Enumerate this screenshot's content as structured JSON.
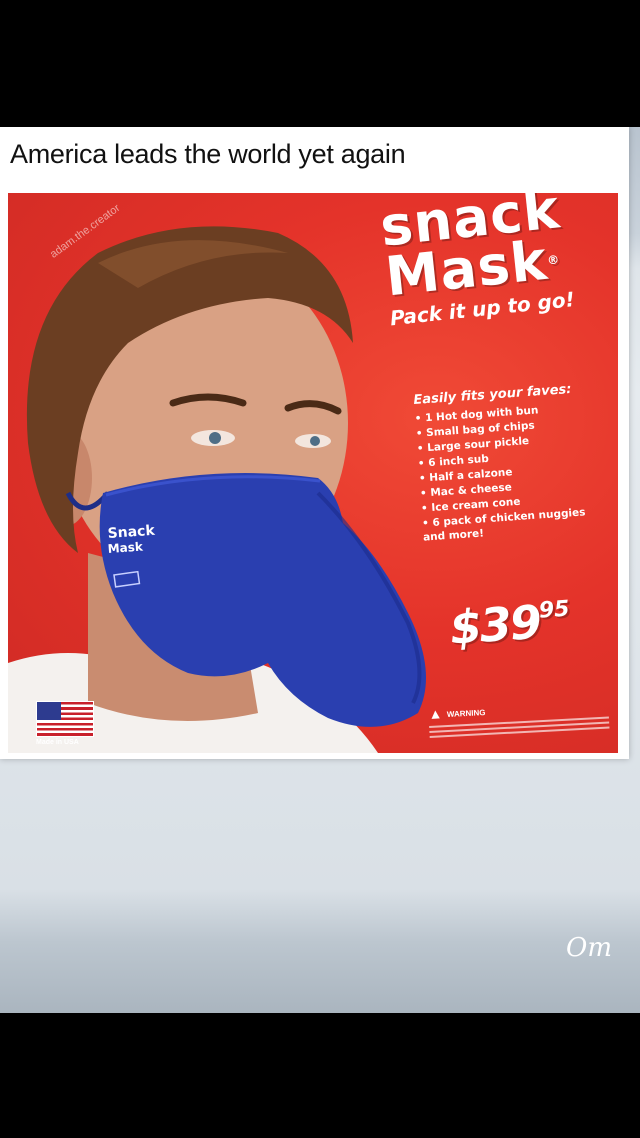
{
  "caption": "America leads the world yet again",
  "ad": {
    "brand_line1": "snack",
    "brand_line2": "Mask",
    "brand_reg": "®",
    "tagline": "Pack it up to go!",
    "list_heading": "Easily fits your faves:",
    "items": [
      "1 Hot dog with bun",
      "Small bag of chips",
      "Large sour pickle",
      "6 inch sub",
      "Half a calzone",
      "Mac & cheese",
      "Ice cream cone",
      "6 pack of chicken nuggies"
    ],
    "more": "and more!",
    "price_main": "$39",
    "price_cents": "95",
    "warning_heading": "WARNING",
    "mask_label_line1": "Snack",
    "mask_label_line2": "Mask",
    "made_in": "Made in USA",
    "watermark": "adam.the.creator"
  },
  "signature": "Om",
  "colors": {
    "ad_red": "#e4332a",
    "mask_blue": "#2a3fb0",
    "skin": "#d9a184",
    "hair": "#6b3e22"
  }
}
